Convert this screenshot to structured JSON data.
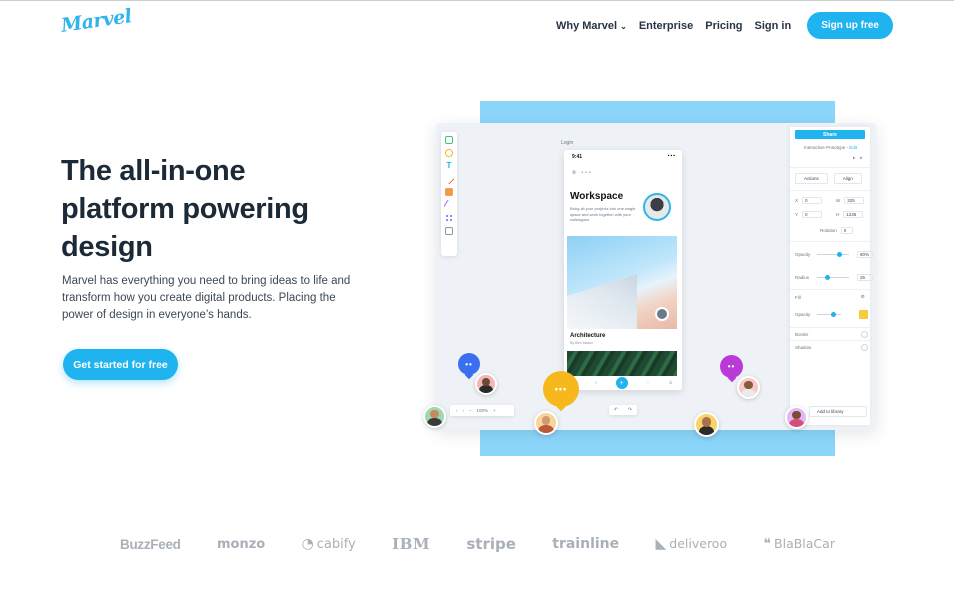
{
  "header": {
    "logo_text": "Marvel",
    "nav": {
      "why_marvel": "Why Marvel",
      "why_marvel_caret": "⌄",
      "enterprise": "Enterprise",
      "pricing": "Pricing",
      "sign_in": "Sign in",
      "sign_up": "Sign up free"
    }
  },
  "hero": {
    "headline": "The all-in-one platform powering design",
    "subtext": "Marvel has everything you need to bring ideas to life and transform how you create digital products. Placing the power of design in everyone’s hands.",
    "cta": "Get started for free"
  },
  "mockup": {
    "screen_label": "Login",
    "phone": {
      "time": "9:41",
      "status": "▪▪▪",
      "icons": "⦾ •••",
      "workspace_title": "Workspace",
      "workspace_text": "Bring all your projects into one single space and work together with your colleagues",
      "card_title": "Architecture",
      "card_sub": "By Alex Mason"
    },
    "zoom_controls": [
      "›",
      "‹",
      "–",
      "100%",
      "+"
    ],
    "undo_controls": [
      "↶",
      "↷"
    ],
    "panel": {
      "share_button": "Share",
      "prototype_label": "Interactive Prototype -",
      "prototype_link": "Edit",
      "tabs": [
        "Actions",
        "Align"
      ],
      "x_label": "X",
      "x_value": "0",
      "w_label": "W",
      "w_value": "325",
      "y_label": "Y",
      "y_value": "0",
      "h_label": "H",
      "h_value": "1236",
      "rotation_label": "Rotation",
      "rotation_value": "0",
      "opacity_label": "Opacity",
      "opacity_value": "80%",
      "radius_label": "Radius",
      "radius_value": "25",
      "fill_label": "Fill",
      "fill_opacity_label": "Opacity",
      "fill_color": "#f7cb3b",
      "border_label": "Border",
      "shadow_label": "Shadow"
    },
    "add_library": "Add to library",
    "bubbles": [
      {
        "text": "••",
        "color": "#3b6ff0"
      },
      {
        "text": "•••",
        "color": "#f6b81c"
      },
      {
        "text": "••",
        "color": "#b93ad7"
      }
    ]
  },
  "logos": [
    "BuzzFeed",
    "monzo",
    "cabify",
    "IBM",
    "stripe",
    "trainline",
    "deliveroo",
    "BlaBlaCar"
  ],
  "colors": {
    "accent": "#1fb3ef",
    "heading": "#1c2a38",
    "mockup_bg": "#8cd6fb",
    "logo_gray": "#a9b0b8"
  }
}
